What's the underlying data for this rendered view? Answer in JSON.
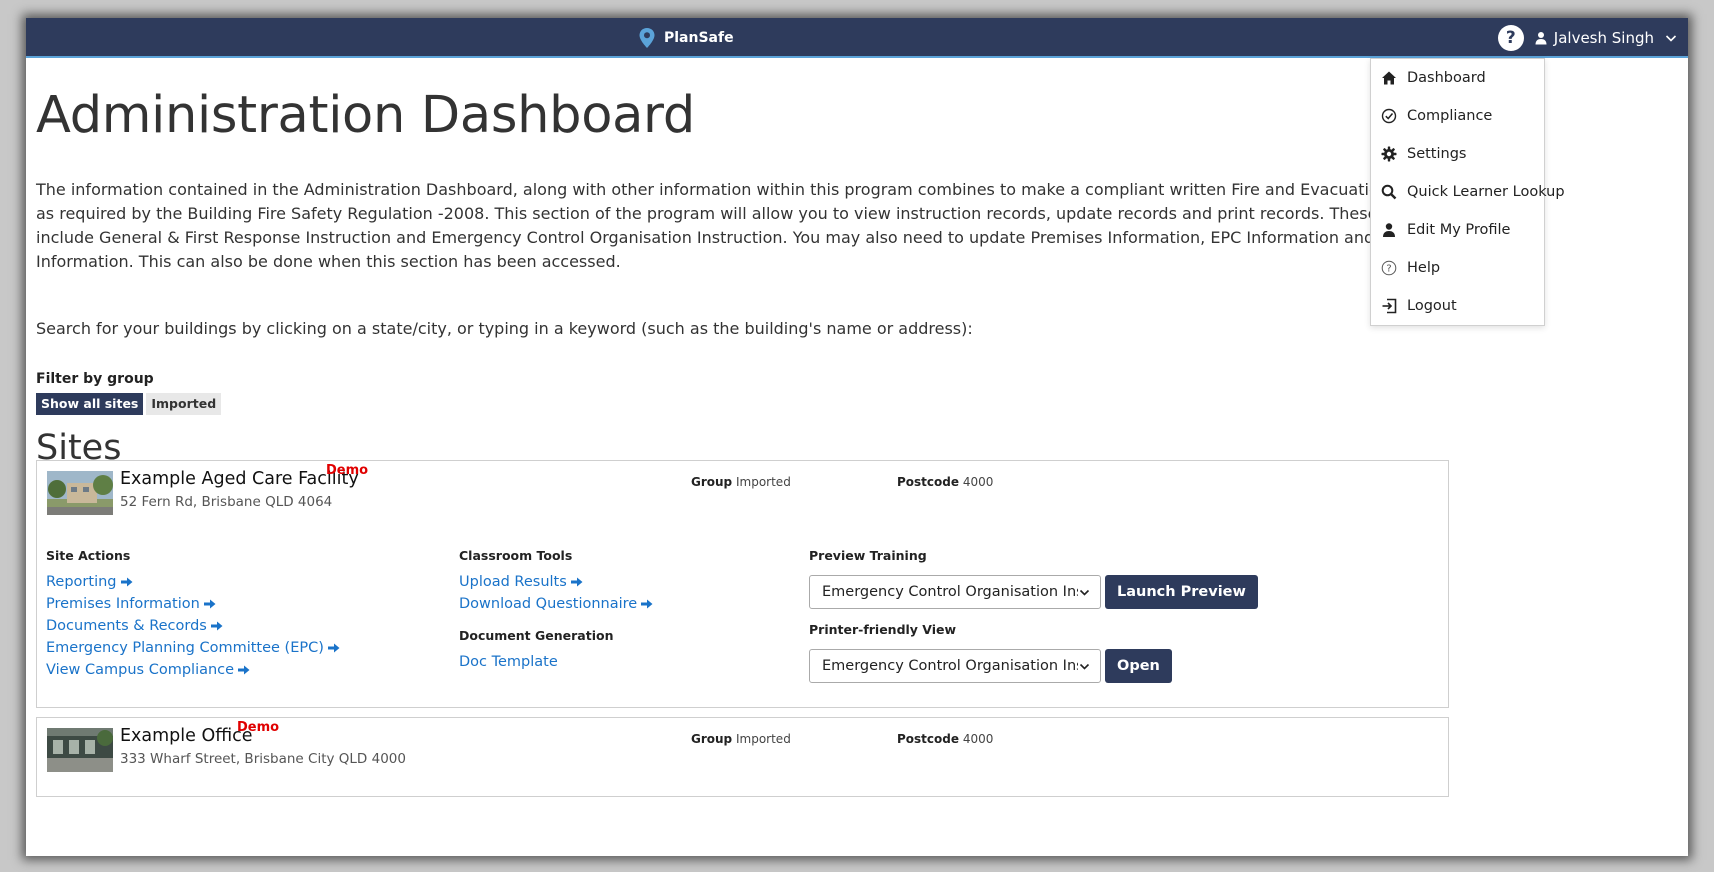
{
  "header": {
    "brand": "PlanSafe",
    "help_symbol": "?",
    "user_name": "Jalvesh Singh"
  },
  "page": {
    "title": "Administration Dashboard",
    "intro": "The information contained in the Administration Dashboard, along with other information within this program combines to make a compliant written Fire and Evacuation Plan as required by the Building Fire Safety Regulation -2008. This section of the program will allow you to view instruction records, update records and print records. These records include General & First Response Instruction and Emergency Control Organisation Instruction. You may also need to update Premises Information, EPC Information and ECO Information. This can also be done when this section has been accessed.",
    "search_hint": "Search for your buildings by clicking on a state/city, or typing in a keyword (such as the building's name or address):",
    "filter_label": "Filter by group",
    "filters": [
      "Show all sites",
      "Imported"
    ],
    "sites_heading": "Sites"
  },
  "labels": {
    "group": "Group",
    "postcode": "Postcode",
    "demo": "Demo",
    "site_actions": "Site Actions",
    "classroom_tools": "Classroom Tools",
    "document_generation": "Document Generation",
    "preview_training": "Preview Training",
    "printer_friendly": "Printer-friendly View"
  },
  "sites": [
    {
      "name": "Example Aged Care Facility",
      "address": "52 Fern Rd, Brisbane QLD 4064",
      "group": "Imported",
      "postcode": "4000",
      "site_actions": [
        "Reporting",
        "Premises Information",
        "Documents & Records",
        "Emergency Planning Committee (EPC)",
        "View Campus Compliance"
      ],
      "classroom_tools": [
        "Upload Results",
        "Download Questionnaire"
      ],
      "document_generation": [
        "Doc Template"
      ],
      "preview_training_selected": "Emergency Control Organisation Instruction",
      "preview_button": "Launch Preview",
      "printer_selected": "Emergency Control Organisation Instruction",
      "open_button": "Open"
    },
    {
      "name": "Example Office",
      "address": "333 Wharf Street, Brisbane City QLD 4000",
      "group": "Imported",
      "postcode": "4000"
    }
  ],
  "user_menu": [
    {
      "label": "Dashboard",
      "icon": "home-icon"
    },
    {
      "label": "Compliance",
      "icon": "check-circle-icon"
    },
    {
      "label": "Settings",
      "icon": "gear-icon"
    },
    {
      "label": "Quick Learner Lookup",
      "icon": "search-icon"
    },
    {
      "label": "Edit My Profile",
      "icon": "user-icon"
    },
    {
      "label": "Help",
      "icon": "question-circle-icon"
    },
    {
      "label": "Logout",
      "icon": "logout-icon"
    }
  ],
  "colors": {
    "navbar": "#2e3b5c",
    "link": "#1a73c9",
    "demo": "#e00000",
    "button": "#2e3b5c"
  }
}
